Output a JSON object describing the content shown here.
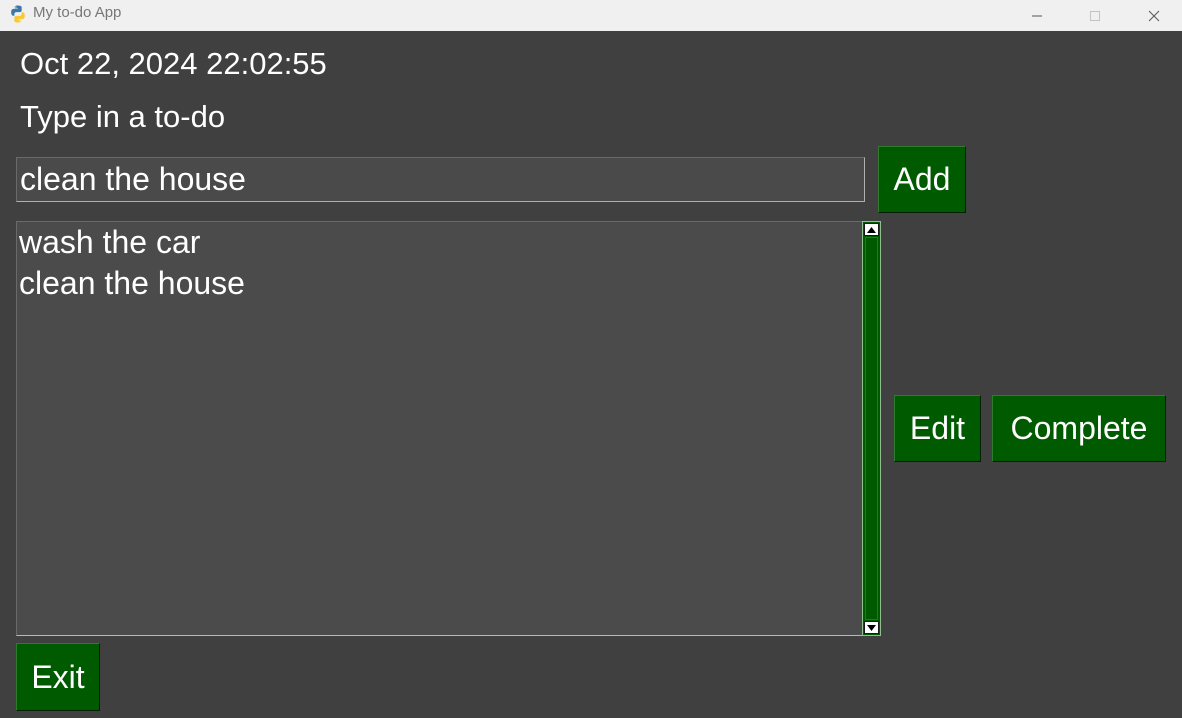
{
  "window": {
    "title": "My to-do App",
    "icon": "python-icon",
    "controls": [
      "minimize-icon",
      "maximize-icon",
      "close-icon"
    ]
  },
  "clock": {
    "text": "Oct 22, 2024 22:02:55"
  },
  "prompt": {
    "text": "Type in a to-do"
  },
  "input": {
    "value": "clean the house"
  },
  "buttons": {
    "add": "Add",
    "edit": "Edit",
    "complete": "Complete",
    "exit": "Exit"
  },
  "todos": [
    "wash the car",
    "clean the house"
  ],
  "colors": {
    "background": "#404040",
    "button": "#005a00",
    "field": "#4b4b4b",
    "text": "#ffffff",
    "titlebar": "#f0f0f0"
  }
}
